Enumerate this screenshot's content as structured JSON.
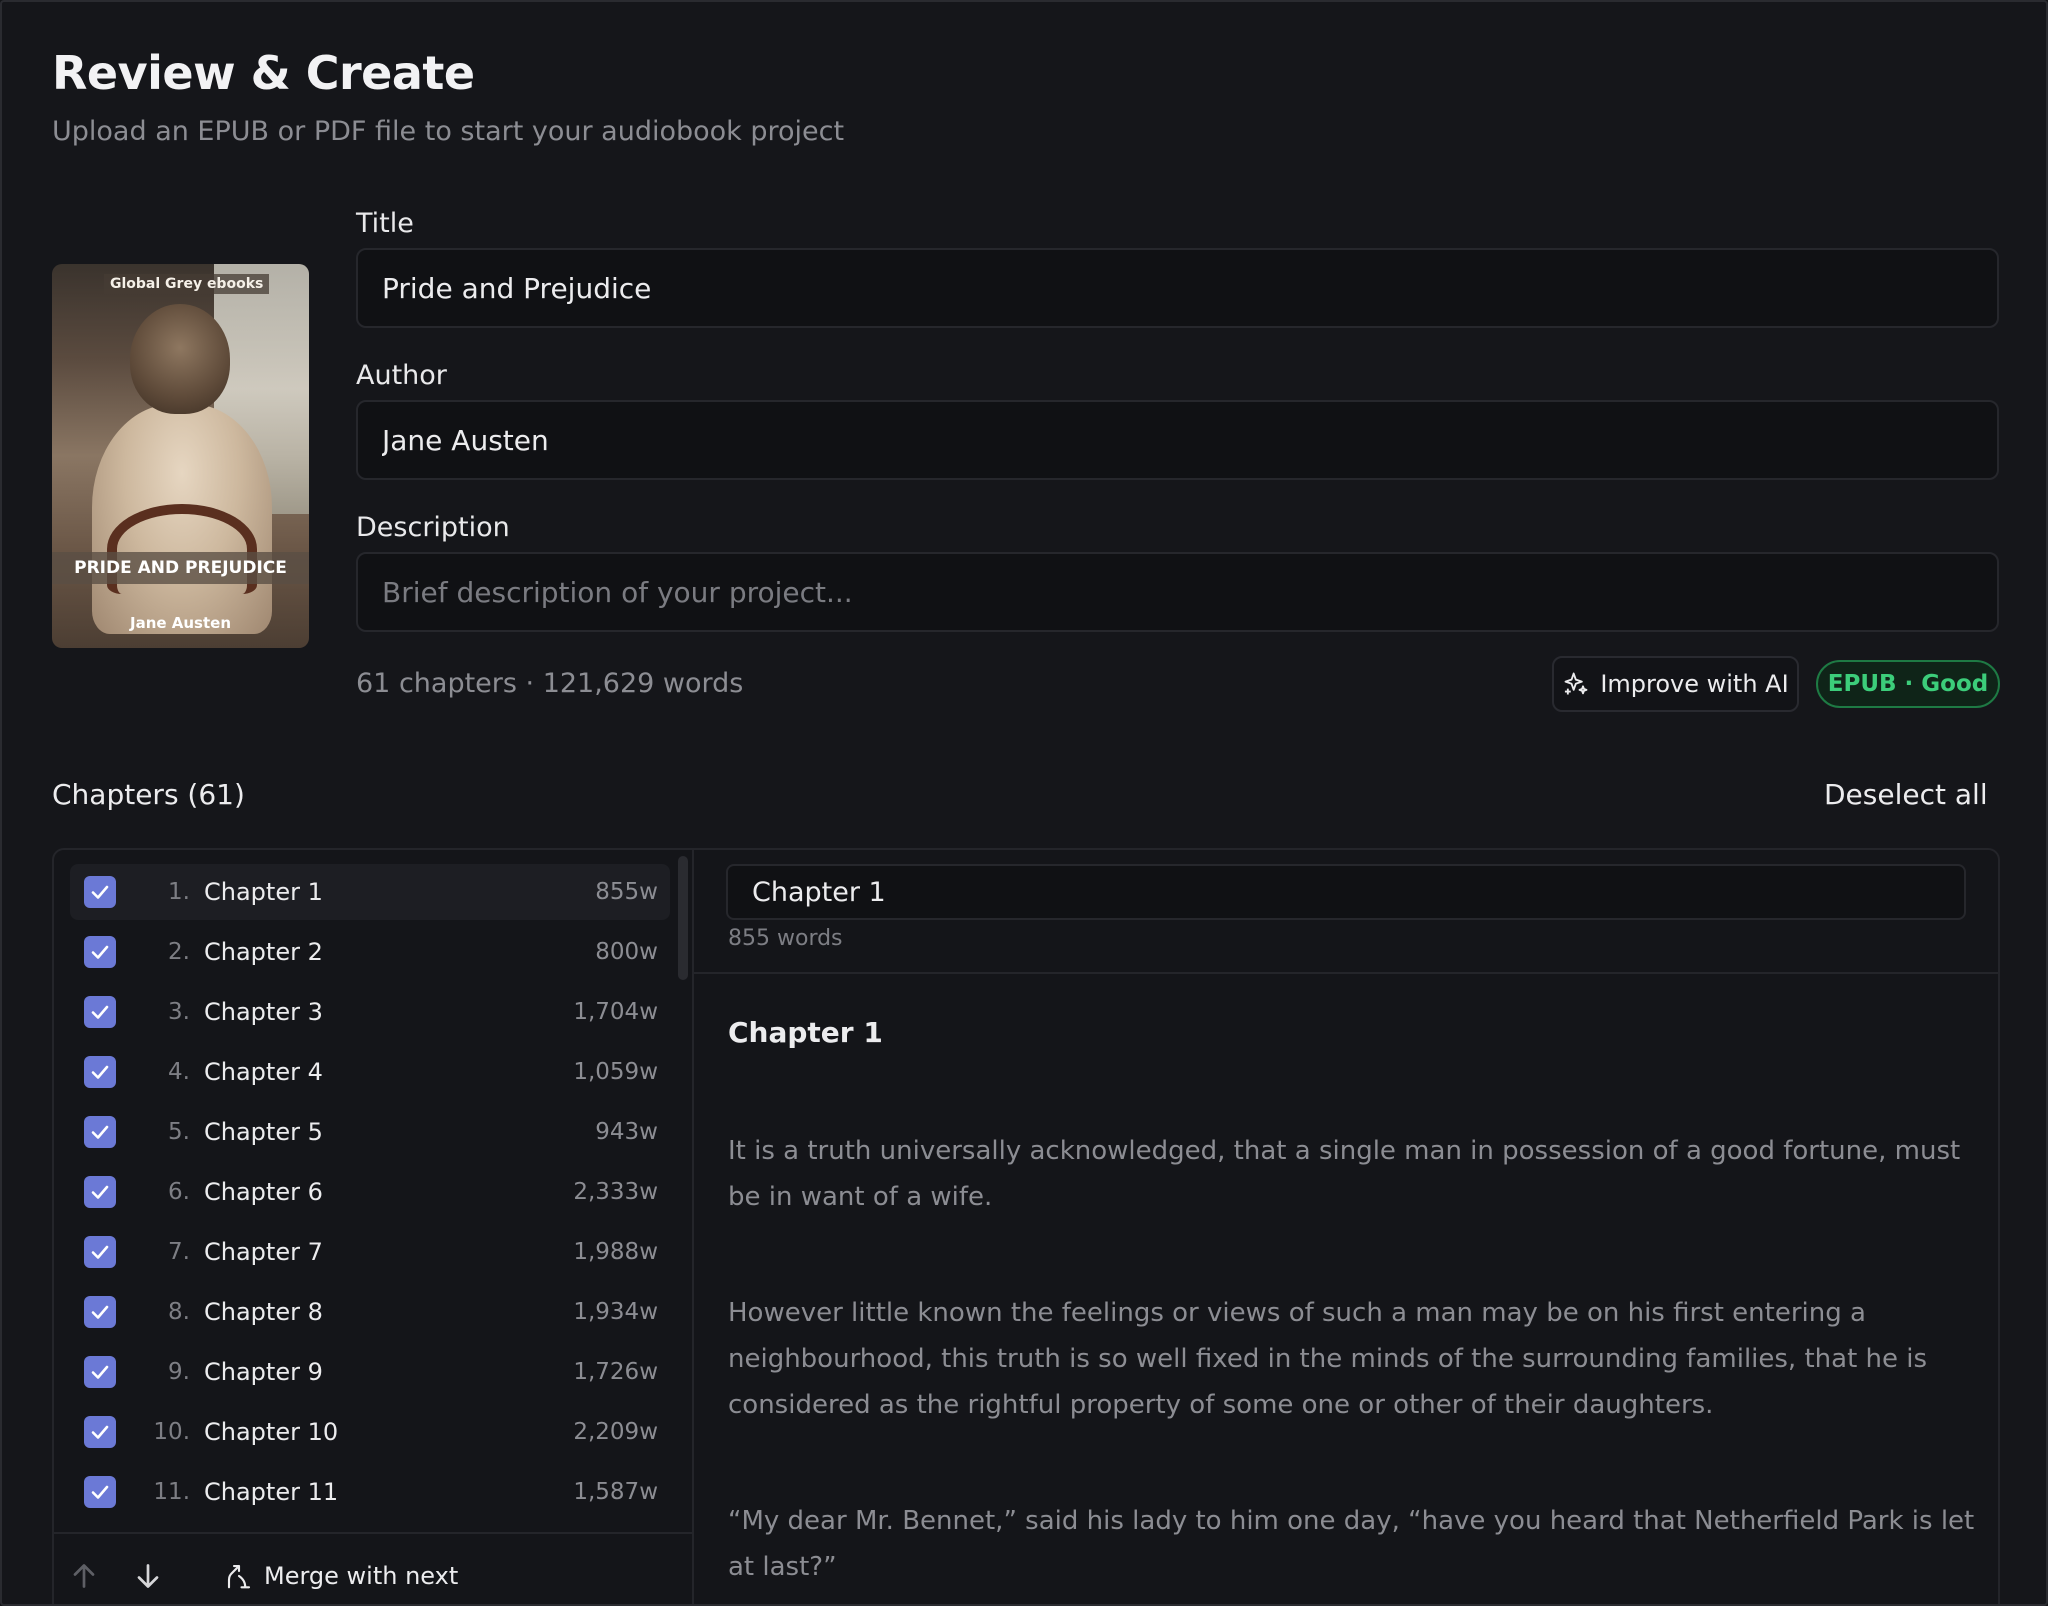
{
  "header": {
    "title": "Review & Create",
    "subtitle": "Upload an EPUB or PDF file to start your audiobook project"
  },
  "cover": {
    "publisher": "Global Grey ebooks",
    "title": "PRIDE AND PREJUDICE",
    "author": "Jane Austen"
  },
  "form": {
    "title_label": "Title",
    "title_value": "Pride and Prejudice",
    "author_label": "Author",
    "author_value": "Jane Austen",
    "description_label": "Description",
    "description_value": "",
    "description_placeholder": "Brief description of your project..."
  },
  "meta": {
    "stats": "61 chapters · 121,629 words",
    "improve_label": "Improve with AI",
    "badge": "EPUB · Good"
  },
  "chapters": {
    "heading": "Chapters (61)",
    "deselect_label": "Deselect all",
    "items": [
      {
        "num": "1.",
        "title": "Chapter 1",
        "words": "855w",
        "checked": true
      },
      {
        "num": "2.",
        "title": "Chapter 2",
        "words": "800w",
        "checked": true
      },
      {
        "num": "3.",
        "title": "Chapter 3",
        "words": "1,704w",
        "checked": true
      },
      {
        "num": "4.",
        "title": "Chapter 4",
        "words": "1,059w",
        "checked": true
      },
      {
        "num": "5.",
        "title": "Chapter 5",
        "words": "943w",
        "checked": true
      },
      {
        "num": "6.",
        "title": "Chapter 6",
        "words": "2,333w",
        "checked": true
      },
      {
        "num": "7.",
        "title": "Chapter 7",
        "words": "1,988w",
        "checked": true
      },
      {
        "num": "8.",
        "title": "Chapter 8",
        "words": "1,934w",
        "checked": true
      },
      {
        "num": "9.",
        "title": "Chapter 9",
        "words": "1,726w",
        "checked": true
      },
      {
        "num": "10.",
        "title": "Chapter 10",
        "words": "2,209w",
        "checked": true
      },
      {
        "num": "11.",
        "title": "Chapter 11",
        "words": "1,587w",
        "checked": true
      }
    ],
    "merge_label": "Merge with next"
  },
  "editor": {
    "chapter_title": "Chapter 1",
    "word_count": "855 words",
    "body_heading": "Chapter 1",
    "paragraphs": [
      "It is a truth universally acknowledged, that a single man in possession of a good fortune, must be in want of a wife.",
      "However little known the feelings or views of such a man may be on his first entering a neighbourhood, this truth is so well fixed in the minds of the surrounding families, that he is considered as the rightful property of some one or other of their daughters.",
      "“My dear Mr. Bennet,” said his lady to him one day, “have you heard that Netherfield Park is let at last?”"
    ]
  },
  "colors": {
    "accent_checkbox": "#6b79d6",
    "badge_green": "#3ccd7a",
    "background": "#15161a"
  },
  "icons": {
    "improve": "sparkles-icon",
    "checkbox": "checkmark-icon",
    "move_up": "arrow-up-icon",
    "move_down": "arrow-down-icon",
    "merge": "merge-icon"
  }
}
